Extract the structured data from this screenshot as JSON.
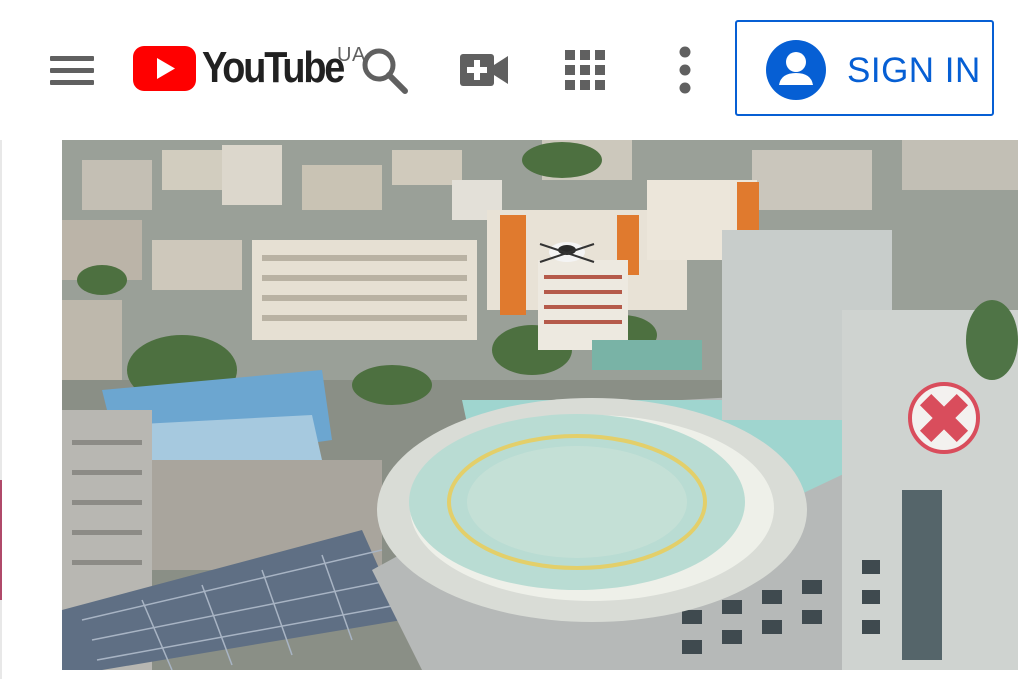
{
  "header": {
    "logo_text": "YouTube",
    "region": "UA",
    "signin_label": "SIGN IN"
  },
  "icons": {
    "menu": "hamburger-menu-icon",
    "search": "search-icon",
    "create": "video-camera-plus-icon",
    "apps": "apps-grid-icon",
    "more": "vertical-dots-icon",
    "account": "account-circle-icon"
  },
  "colors": {
    "brand_red": "#ff0000",
    "accent_blue": "#065fd4",
    "icon_gray": "#606060"
  },
  "thumbnail": {
    "subject": "drone-on-hospital-helipad"
  }
}
